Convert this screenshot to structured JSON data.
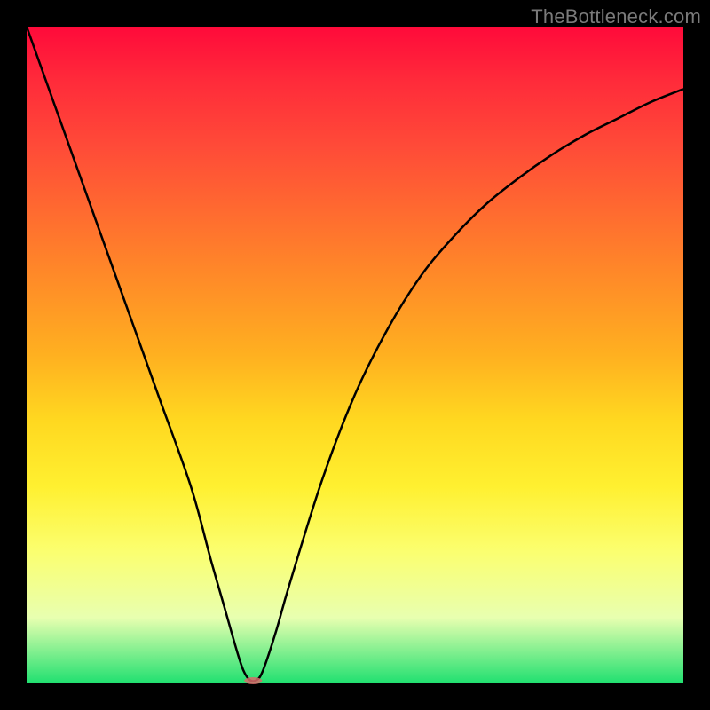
{
  "watermark": "TheBottleneck.com",
  "chart_data": {
    "type": "line",
    "title": "",
    "xlabel": "",
    "ylabel": "",
    "xlim": [
      0,
      100
    ],
    "ylim": [
      0,
      100
    ],
    "x": [
      0,
      5,
      10,
      15,
      20,
      25,
      28,
      30,
      32,
      33,
      34,
      35,
      36,
      38,
      40,
      45,
      50,
      55,
      60,
      65,
      70,
      75,
      80,
      85,
      90,
      95,
      100
    ],
    "values": [
      100,
      86,
      72,
      58,
      44,
      30,
      19,
      12,
      5,
      2,
      0.5,
      0.5,
      2,
      8,
      15,
      31,
      44,
      54,
      62,
      68,
      73,
      77,
      80.5,
      83.5,
      86,
      88.5,
      90.5
    ],
    "minimum_x": 34.5,
    "minimum_y": 0.4,
    "marker": {
      "x_range": [
        33.5,
        35.5
      ],
      "y": 0.4
    }
  },
  "colors": {
    "curve": "#000000",
    "background_top": "#ff0a3a",
    "background_bottom": "#20e070",
    "frame": "#000000",
    "marker": "#d86a6a"
  }
}
